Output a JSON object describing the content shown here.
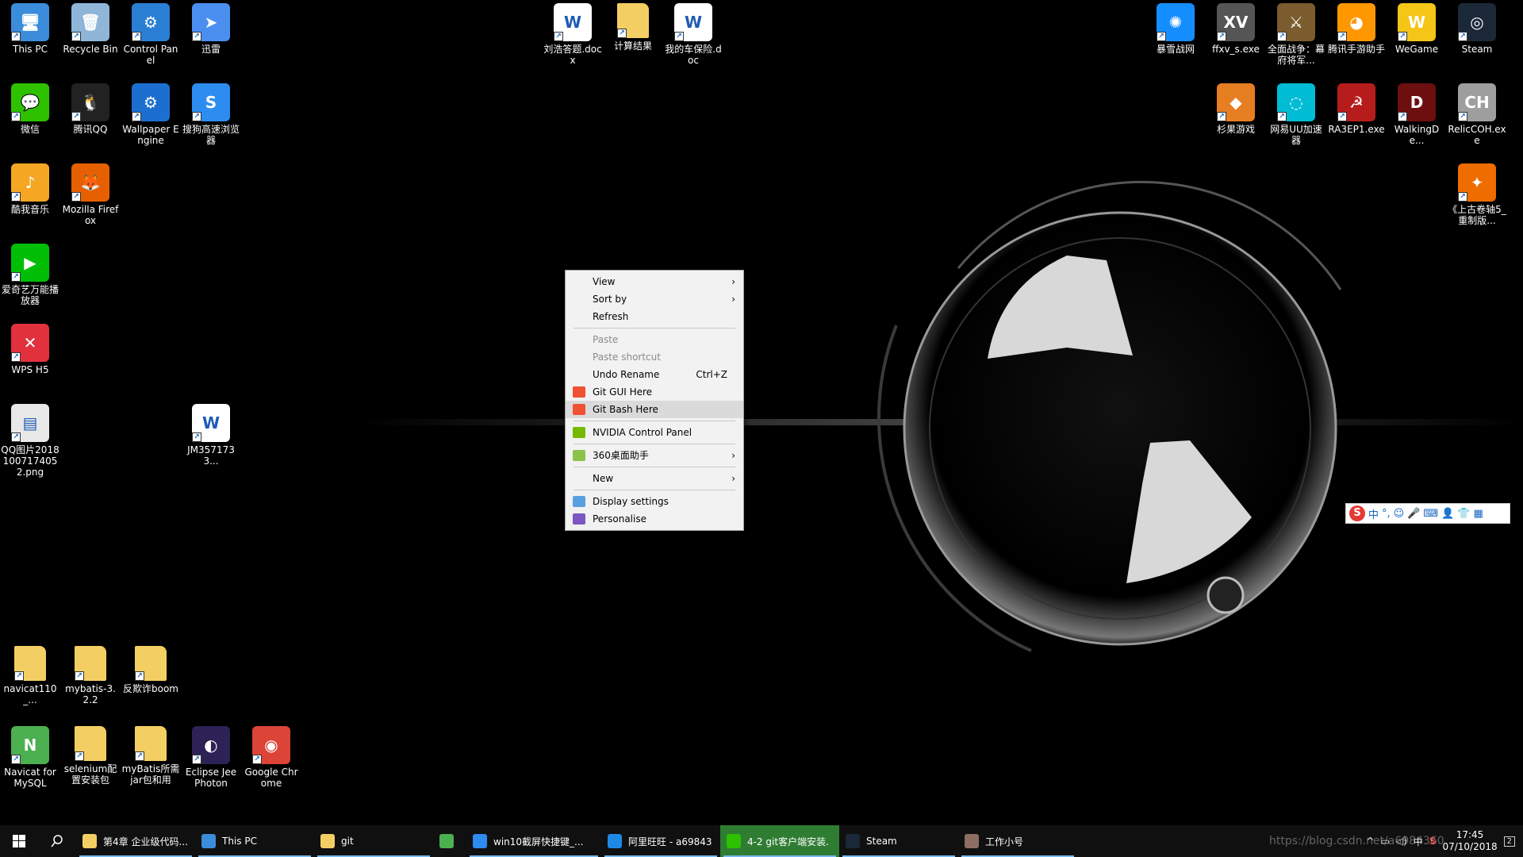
{
  "desktop": {
    "icons": [
      {
        "label": "This PC",
        "icon": "computer-icon",
        "color": "#3b8ddb"
      },
      {
        "label": "Recycle Bin",
        "icon": "recycle-bin-icon",
        "color": "#8fb6d8"
      },
      {
        "label": "Control Panel",
        "icon": "control-panel-icon",
        "color": "#2a7fd4"
      },
      {
        "label": "迅雷",
        "icon": "xunlei-icon",
        "color": "#4a8ff0"
      },
      {
        "label": "微信",
        "icon": "wechat-icon",
        "color": "#2dc100"
      },
      {
        "label": "腾讯QQ",
        "icon": "qq-icon",
        "color": "#222222"
      },
      {
        "label": "Wallpaper Engine",
        "icon": "wallpaper-engine-icon",
        "color": "#1c6fd0"
      },
      {
        "label": "搜狗高速浏览器",
        "icon": "sogou-browser-icon",
        "color": "#2d8cf0"
      },
      {
        "label": "酷我音乐",
        "icon": "kuwo-music-icon",
        "color": "#f5a623"
      },
      {
        "label": "Mozilla Firefox",
        "icon": "firefox-icon",
        "color": "#e66000"
      },
      {
        "label": "爱奇艺万能播放器",
        "icon": "iqiyi-player-icon",
        "color": "#00be06"
      },
      {
        "label": "WPS H5",
        "icon": "wps-h5-icon",
        "color": "#e0313d"
      },
      {
        "label": "QQ图片20181007174052.png",
        "icon": "image-file-icon",
        "color": "#e8e8e8"
      },
      {
        "label": "JM3571733...",
        "icon": "word-document-icon",
        "color": "#ffffff"
      },
      {
        "label": "navicat110_...",
        "icon": "folder-icon",
        "color": "#f3cf63"
      },
      {
        "label": "mybatis-3.2.2",
        "icon": "folder-icon",
        "color": "#f3cf63"
      },
      {
        "label": "反欺诈boom",
        "icon": "folder-icon",
        "color": "#f3cf63"
      },
      {
        "label": "Navicat for MySQL",
        "icon": "navicat-icon",
        "color": "#4caf50"
      },
      {
        "label": "selenium配置安装包",
        "icon": "folder-icon",
        "color": "#f3cf63"
      },
      {
        "label": "myBatis所需jar包和用",
        "icon": "folder-icon",
        "color": "#f3cf63"
      },
      {
        "label": "Eclipse Jee Photon",
        "icon": "eclipse-icon",
        "color": "#2c2255"
      },
      {
        "label": "Google Chrome",
        "icon": "chrome-icon",
        "color": "#db4437"
      },
      {
        "label": "刘浩答题.docx",
        "icon": "word-document-icon",
        "color": "#ffffff"
      },
      {
        "label": "计算结果",
        "icon": "folder-icon",
        "color": "#f3cf63"
      },
      {
        "label": "我的车保险.doc",
        "icon": "word-document-icon",
        "color": "#ffffff"
      },
      {
        "label": "暴雪战网",
        "icon": "battlenet-icon",
        "color": "#148eff"
      },
      {
        "label": "ffxv_s.exe",
        "icon": "ffxv-icon",
        "color": "#555555"
      },
      {
        "label": "全面战争：幕府将军...",
        "icon": "total-war-icon",
        "color": "#7a5c2e"
      },
      {
        "label": "腾讯手游助手",
        "icon": "tencent-mobile-icon",
        "color": "#ff9800"
      },
      {
        "label": "WeGame",
        "icon": "wegame-icon",
        "color": "#f5c518"
      },
      {
        "label": "Steam",
        "icon": "steam-icon",
        "color": "#1b2838"
      },
      {
        "label": "杉果游戏",
        "icon": "sonkwo-icon",
        "color": "#e67e22"
      },
      {
        "label": "网易UU加速器",
        "icon": "uu-accelerator-icon",
        "color": "#00bcd4"
      },
      {
        "label": "RA3EP1.exe",
        "icon": "red-alert-icon",
        "color": "#b71c1c"
      },
      {
        "label": "WalkingDe...",
        "icon": "walking-dead-icon",
        "color": "#6d0f0f"
      },
      {
        "label": "RelicCOH.exe",
        "icon": "relic-coh-icon",
        "color": "#9e9e9e"
      },
      {
        "label": "《上古卷轴5_重制版...",
        "icon": "skyrim-icon",
        "color": "#ef6c00"
      }
    ]
  },
  "context_menu": {
    "items": [
      {
        "label": "View",
        "submenu": true
      },
      {
        "label": "Sort by",
        "submenu": true
      },
      {
        "label": "Refresh"
      },
      {
        "separator": true
      },
      {
        "label": "Paste",
        "disabled": true
      },
      {
        "label": "Paste shortcut",
        "disabled": true
      },
      {
        "label": "Undo Rename",
        "shortcut": "Ctrl+Z"
      },
      {
        "label": "Git GUI Here",
        "icon": "git-icon"
      },
      {
        "label": "Git Bash Here",
        "icon": "git-icon",
        "highlighted": true
      },
      {
        "separator": true
      },
      {
        "label": "NVIDIA Control Panel",
        "icon": "nvidia-icon"
      },
      {
        "separator": true
      },
      {
        "label": "360桌面助手",
        "icon": "360-icon",
        "submenu": true
      },
      {
        "separator": true
      },
      {
        "label": "New",
        "submenu": true
      },
      {
        "separator": true
      },
      {
        "label": "Display settings",
        "icon": "display-icon"
      },
      {
        "label": "Personalise",
        "icon": "personalise-icon"
      }
    ]
  },
  "ime_bar": {
    "mode": "中",
    "punct": "°,"
  },
  "taskbar": {
    "items": [
      {
        "label": "第4章 企业级代码...",
        "icon": "folder-icon",
        "color": "#f3cf63",
        "open": true
      },
      {
        "label": "This PC",
        "icon": "computer-icon",
        "color": "#3b8ddb",
        "open": true
      },
      {
        "label": "git",
        "icon": "folder-icon",
        "color": "#f3cf63",
        "open": true
      },
      {
        "label": "",
        "icon": "360-icon",
        "color": "#4caf50",
        "open": false
      },
      {
        "label": "win10截屏快捷键_...",
        "icon": "sogou-browser-icon",
        "color": "#2d8cf0",
        "open": true
      },
      {
        "label": "阿里旺旺 - a69843",
        "icon": "aliwangwang-icon",
        "color": "#1e88e5",
        "open": true
      },
      {
        "label": "4-2 git客户端安装.",
        "icon": "wechat-icon",
        "color": "#2dc100",
        "open": true,
        "active": true
      },
      {
        "label": "Steam",
        "icon": "steam-icon",
        "color": "#1b2838",
        "open": true
      },
      {
        "label": "工作小号",
        "icon": "avatar-icon",
        "color": "#8d6e63",
        "open": true
      }
    ],
    "tray": {
      "ime": "中",
      "time": "17:45",
      "date": "07/10/2018",
      "notifications": "2"
    }
  },
  "watermark": "https://blog.csdn.net/a6984360"
}
